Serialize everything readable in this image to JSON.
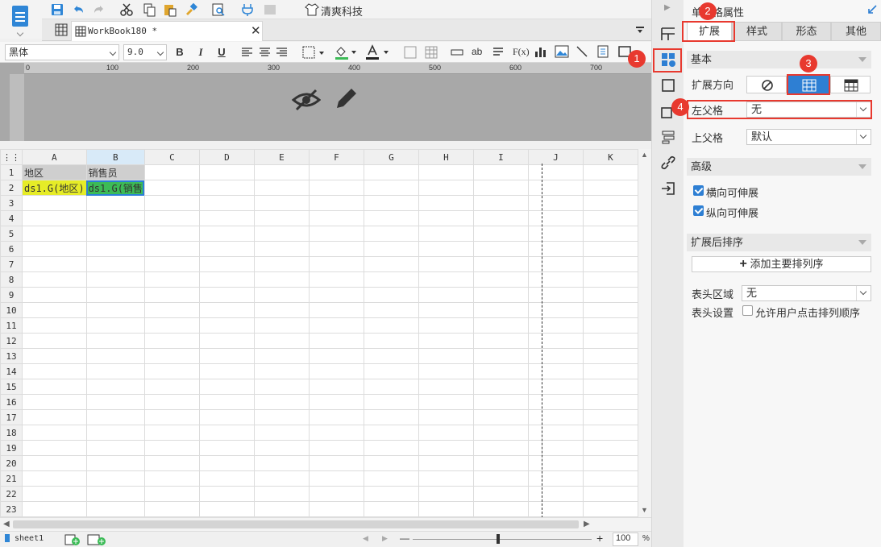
{
  "toolbar": {
    "template_label": "清爽科技"
  },
  "tabs": {
    "doc_name": "WorkBook180 *"
  },
  "format": {
    "font_family": "黑体",
    "font_size": "9.0",
    "bold": "B",
    "italic": "I",
    "underline": "U",
    "text_tool": "ab",
    "formula_tool": "F(x)"
  },
  "grid": {
    "columns": [
      "A",
      "B",
      "C",
      "D",
      "E",
      "F",
      "G",
      "H",
      "I",
      "J",
      "K"
    ],
    "rows": [
      "1",
      "2",
      "3",
      "4",
      "5",
      "6",
      "7",
      "8",
      "9",
      "10",
      "11",
      "12",
      "13",
      "14",
      "15",
      "16",
      "17",
      "18",
      "19",
      "20",
      "21",
      "22",
      "23"
    ],
    "cells": {
      "A1": "地区",
      "B1": "销售员",
      "A2": "ds1.G(地区)",
      "B2": "ds1.G(销售"
    }
  },
  "status": {
    "sheet_name": "sheet1",
    "zoom_minus": "—",
    "zoom_plus": "+",
    "zoom_value": "100",
    "zoom_unit": "%"
  },
  "panel": {
    "title": "单元格属性",
    "tabs": [
      "扩展",
      "样式",
      "形态",
      "其他"
    ],
    "section_basic": "基本",
    "expand_direction_label": "扩展方向",
    "left_parent_label": "左父格",
    "left_parent_value": "无",
    "top_parent_label": "上父格",
    "top_parent_value": "默认",
    "section_advanced": "高级",
    "horizontal_expand": "横向可伸展",
    "vertical_expand": "纵向可伸展",
    "section_sort": "扩展后排序",
    "add_sort_button": "添加主要排列序",
    "header_area_label": "表头区域",
    "header_area_value": "无",
    "header_setting_label": "表头设置",
    "allow_user_sort": "允许用户点击排列顺序"
  },
  "annotations": [
    "1",
    "2",
    "3",
    "4"
  ],
  "colors": {
    "accent_blue": "#2e7fd3",
    "annotation_red": "#e8392f",
    "cell_yellow": "#e6ec27",
    "cell_green": "#3cbb57"
  }
}
